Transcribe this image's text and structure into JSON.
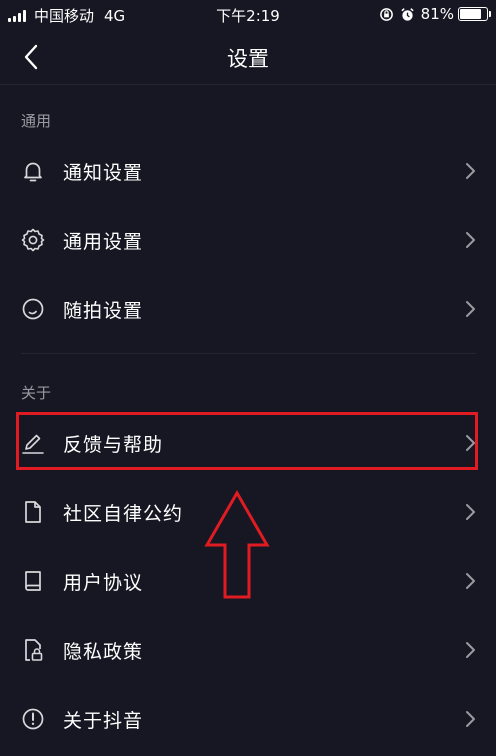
{
  "status_bar": {
    "carrier": "中国移动",
    "network": "4G",
    "time": "下午2:19",
    "battery": "81%",
    "battery_level": 0.81
  },
  "nav": {
    "title": "设置",
    "back_icon": "chevron-left-icon"
  },
  "sections": [
    {
      "header": "通用",
      "items": [
        {
          "label": "通知设置",
          "icon": "bell-icon"
        },
        {
          "label": "通用设置",
          "icon": "gear-icon"
        },
        {
          "label": "随拍设置",
          "icon": "circle-icon"
        }
      ]
    },
    {
      "header": "关于",
      "items": [
        {
          "label": "反馈与帮助",
          "icon": "pencil-icon"
        },
        {
          "label": "社区自律公约",
          "icon": "document-icon"
        },
        {
          "label": "用户协议",
          "icon": "book-icon"
        },
        {
          "label": "隐私政策",
          "icon": "lock-document-icon"
        },
        {
          "label": "关于抖音",
          "icon": "info-icon"
        }
      ]
    }
  ],
  "colors": {
    "background": "#161722",
    "highlight": "#e01b22",
    "secondary_text": "#9a9aa2"
  }
}
